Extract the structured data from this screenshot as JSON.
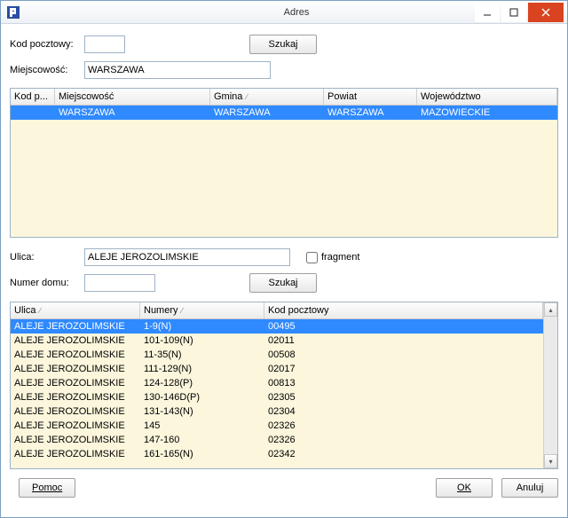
{
  "window": {
    "title": "Adres"
  },
  "labels": {
    "postal": "Kod pocztowy:",
    "city": "Miejscowość:",
    "street": "Ulica:",
    "houseNo": "Numer domu:",
    "fragment": "fragment"
  },
  "inputs": {
    "postal": "",
    "city": "WARSZAWA",
    "street": "ALEJE JEROZOLIMSKIE",
    "houseNo": ""
  },
  "buttons": {
    "search": "Szukaj",
    "help": "Pomoc",
    "ok": "OK",
    "cancel": "Anuluj"
  },
  "cityTable": {
    "headers": [
      "Kod p...",
      "Miejscowość",
      "Gmina",
      "Powiat",
      "Województwo"
    ],
    "rows": [
      {
        "postal": "",
        "city": "WARSZAWA",
        "gmina": "WARSZAWA",
        "powiat": "WARSZAWA",
        "woj": "MAZOWIECKIE",
        "selected": true
      }
    ]
  },
  "streetTable": {
    "headers": [
      "Ulica",
      "Numery",
      "Kod pocztowy"
    ],
    "rows": [
      {
        "street": "ALEJE JEROZOLIMSKIE",
        "nums": "1-9(N)",
        "postal": "00495",
        "selected": true
      },
      {
        "street": "ALEJE JEROZOLIMSKIE",
        "nums": "101-109(N)",
        "postal": "02011"
      },
      {
        "street": "ALEJE JEROZOLIMSKIE",
        "nums": "11-35(N)",
        "postal": "00508"
      },
      {
        "street": "ALEJE JEROZOLIMSKIE",
        "nums": "111-129(N)",
        "postal": "02017"
      },
      {
        "street": "ALEJE JEROZOLIMSKIE",
        "nums": "124-128(P)",
        "postal": "00813"
      },
      {
        "street": "ALEJE JEROZOLIMSKIE",
        "nums": "130-146D(P)",
        "postal": "02305"
      },
      {
        "street": "ALEJE JEROZOLIMSKIE",
        "nums": "131-143(N)",
        "postal": "02304"
      },
      {
        "street": "ALEJE JEROZOLIMSKIE",
        "nums": "145",
        "postal": "02326"
      },
      {
        "street": "ALEJE JEROZOLIMSKIE",
        "nums": "147-160",
        "postal": "02326"
      },
      {
        "street": "ALEJE JEROZOLIMSKIE",
        "nums": "161-165(N)",
        "postal": "02342"
      }
    ]
  }
}
